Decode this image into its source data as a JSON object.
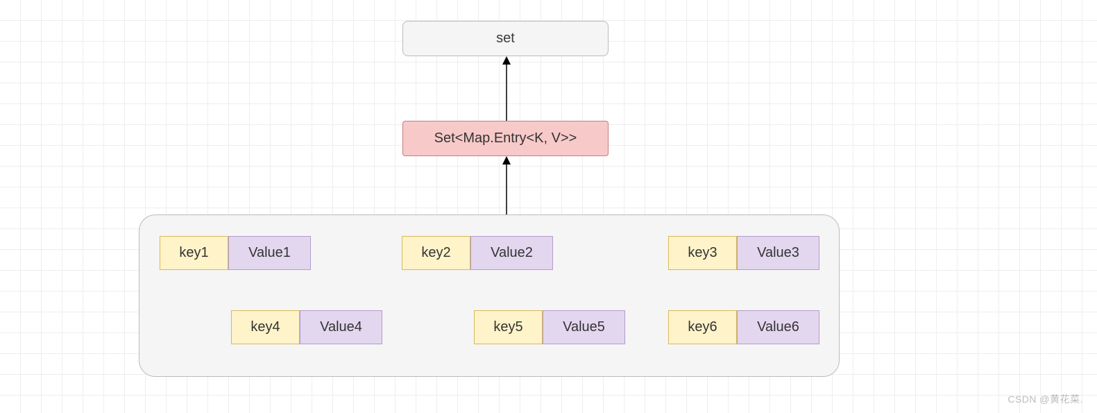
{
  "top_box": {
    "label": "set"
  },
  "type_box": {
    "label": "Set<Map.Entry<K, V>>"
  },
  "entries": [
    {
      "key": "key1",
      "value": "Value1"
    },
    {
      "key": "key2",
      "value": "Value2"
    },
    {
      "key": "key3",
      "value": "Value3"
    },
    {
      "key": "key4",
      "value": "Value4"
    },
    {
      "key": "key5",
      "value": "Value5"
    },
    {
      "key": "key6",
      "value": "Value6"
    }
  ],
  "watermark": "CSDN @黄花菜."
}
